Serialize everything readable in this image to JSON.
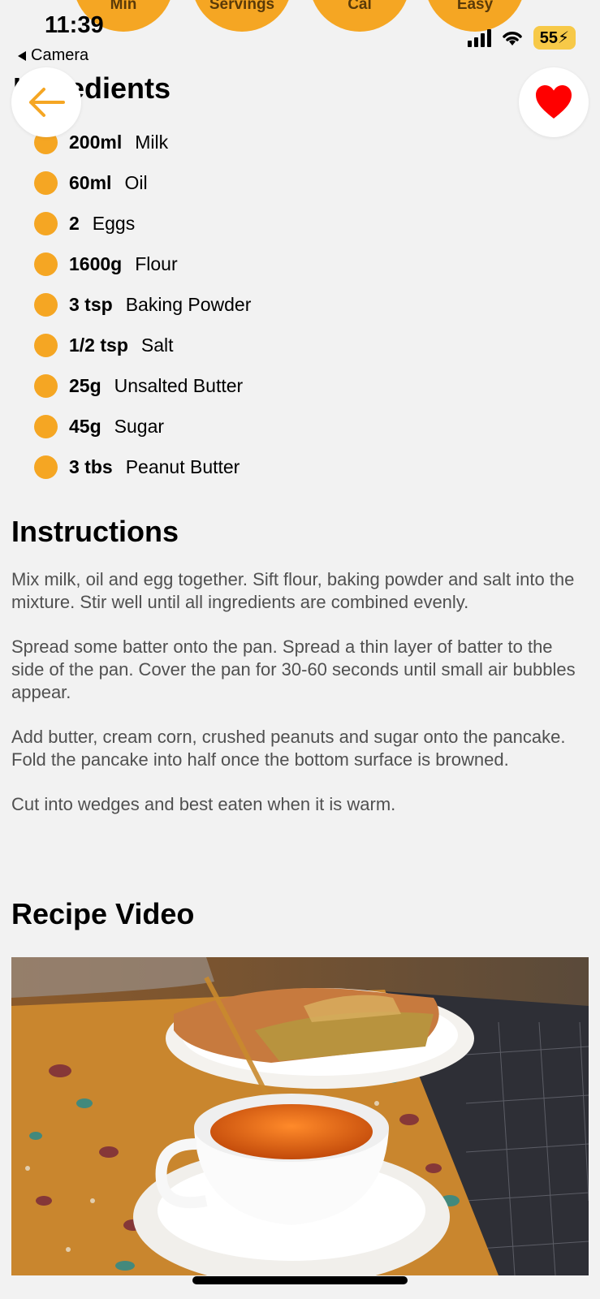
{
  "status_bar": {
    "time": "11:39",
    "back_app": "Camera",
    "battery": "55"
  },
  "stats": [
    {
      "label": "Min"
    },
    {
      "label": "Servings"
    },
    {
      "label": "Cal"
    },
    {
      "label": "Easy"
    }
  ],
  "ingredients": {
    "title": "Ingredients",
    "items": [
      {
        "qty": "200ml",
        "name": "Milk"
      },
      {
        "qty": "60ml",
        "name": "Oil"
      },
      {
        "qty": "2",
        "name": "Eggs"
      },
      {
        "qty": "1600g",
        "name": "Flour"
      },
      {
        "qty": "3 tsp",
        "name": "Baking Powder"
      },
      {
        "qty": "1/2 tsp",
        "name": "Salt"
      },
      {
        "qty": "25g",
        "name": "Unsalted Butter"
      },
      {
        "qty": "45g",
        "name": "Sugar"
      },
      {
        "qty": "3 tbs",
        "name": "Peanut Butter"
      }
    ]
  },
  "instructions": {
    "title": "Instructions",
    "paragraphs": [
      "Mix milk, oil and egg together. Sift flour, baking powder and salt into the mixture. Stir well until all ingredients are combined evenly.",
      "Spread some batter onto the pan. Spread a thin layer of batter to the side of the pan. Cover the pan for 30-60 seconds until small air bubbles appear.",
      "Add butter, cream corn, crushed peanuts and sugar onto the pancake. Fold the pancake into half once the bottom surface is browned.",
      "Cut into wedges and best eaten when it is warm."
    ]
  },
  "video": {
    "title": "Recipe Video"
  },
  "colors": {
    "accent": "#f5a623",
    "heart": "#ff0000",
    "background": "#f2f2f2"
  }
}
